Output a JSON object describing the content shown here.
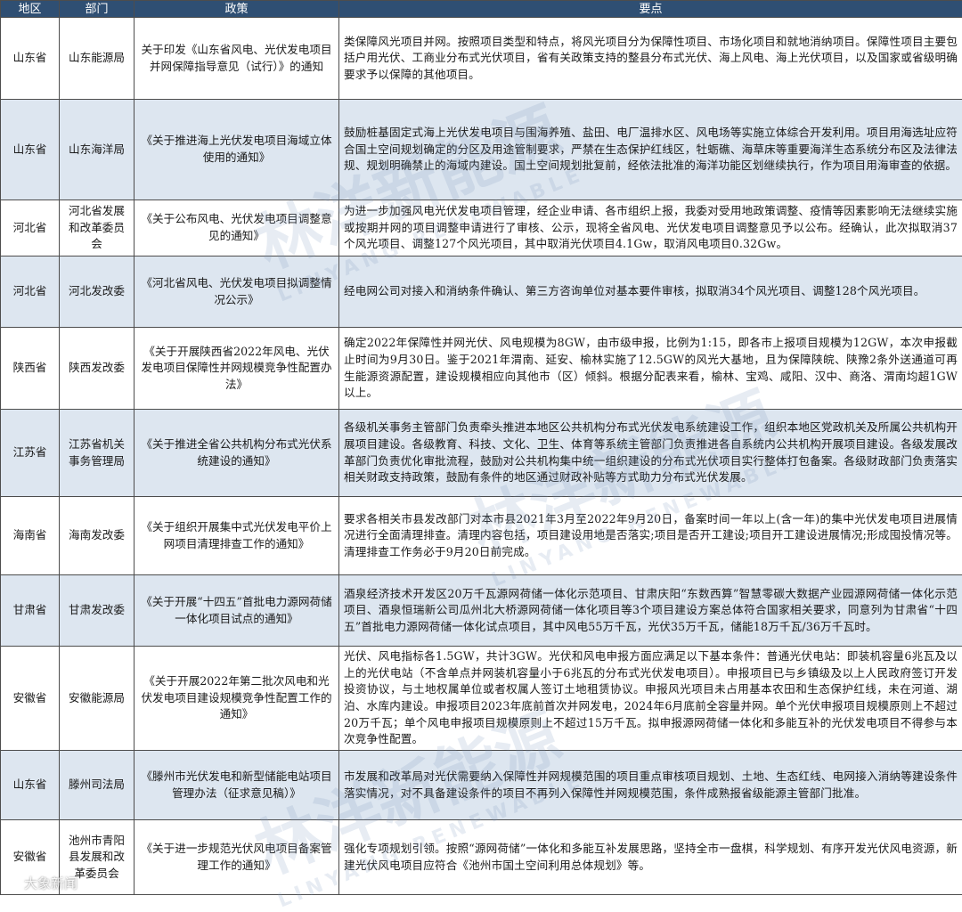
{
  "headers": {
    "region": "地区",
    "department": "部门",
    "policy": "政策",
    "points": "要点"
  },
  "rows": [
    {
      "region": "山东省",
      "department": "山东能源局",
      "policy": "关于印发《山东省风电、光伏发电项目并网保障指导意见（试行）》的通知",
      "points": "类保障风光项目并网。按照项目类型和特点，将风光项目分为保障性项目、市场化项目和就地消纳项目。保障性项目主要包括户用光伏、工商业分布式光伏项目，省有关政策支持的整县分布式光伏、海上风电、海上光伏项目，以及国家或省级明确要求予以保障的其他项目。"
    },
    {
      "region": "山东省",
      "department": "山东海洋局",
      "policy": "《关于推进海上光伏发电项目海域立体使用的通知》",
      "points": "鼓励桩基固定式海上光伏发电项目与围海养殖、盐田、电厂温排水区、风电场等实施立体综合开发利用。项目用海选址应符合国土空间规划确定的分区及用途管制要求，严禁在生态保护红线区，牡蛎礁、海草床等重要海洋生态系统分布区及法律法规、规划明确禁止的海域内建设。国土空间规划批复前，经依法批准的海洋功能区划继续执行，作为项目用海审查的依据。"
    },
    {
      "region": "河北省",
      "department": "河北省发展和改革委员会",
      "policy": "《关于公布风电、光伏发电项目调整意见的通知》",
      "points": "为进一步加强风电光伏发电项目管理，经企业申请、各市组织上报，我委对受用地政策调整、疫情等因素影响无法继续实施或按期并网的项目调整申请进行了审核、公示，现将全省风电、光伏发电项目调整意见予以公布。经确认，此次拟取消37个风光项目、调整127个风光项目，其中取消光伏项目4.1Gw，取消风电项目0.32Gw。"
    },
    {
      "region": "河北省",
      "department": "河北发改委",
      "policy": "《河北省风电、光伏发电项目拟调整情况公示》",
      "points": "经电网公司对接入和消纳条件确认、第三方咨询单位对基本要件审核，拟取消34个风光项目、调整128个风光项目。"
    },
    {
      "region": "陕西省",
      "department": "陕西发改委",
      "policy": "《关于开展陕西省2022年风电、光伏发电项目保障性并网规模竞争性配置办法》",
      "points": "确定2022年保障性并网光伏、风电规模为8GW，由市级申报，比例为1:15，即各市上报项目规模为12GW，本次申报截止时间为9月30日。鉴于2021年渭南、延安、榆林实施了12.5GW的风光大基地，且为保障陕皖、陕豫2条外送通道可再生能源资源配置，建设规模相应向其他市（区）倾斜。根据分配表来看，榆林、宝鸡、咸阳、汉中、商洛、渭南均超1GW以上。"
    },
    {
      "region": "江苏省",
      "department": "江苏省机关事务管理局",
      "policy": "《关于推进全省公共机构分布式光伏系统建设的通知》",
      "points": "各级机关事务主管部门负责牵头推进本地区公共机构分布式光伏发电系统建设工作，组织本地区党政机关及所属公共机构开展项目建设。各级教育、科技、文化、卫生、体育等系统主管部门负责推进各自系统内公共机构开展项目建设。各级发展改革部门负责优化审批流程，鼓励对公共机构集中统一组织建设的分布式光伏项目实行整体打包备案。各级财政部门负责落实相关财政支持政策，鼓励有条件的地区通过财政补贴等方式助力分布式光伏发展。"
    },
    {
      "region": "海南省",
      "department": "海南发改委",
      "policy": "《关于组织开展集中式光伏发电平价上网项目清理排查工作的通知》",
      "points": "要求各相关市县发改部门对本市县2021年3月至2022年9月20日，备案时间一年以上(含一年)的集中光伏发电项目进展情况进行全面清理排查。清理内容包括，项目建设用地是否落实;项目是否开工建设;项目开工建设进展情况;形成囤投情况等。清理排查工作务必于9月20日前完成。"
    },
    {
      "region": "甘肃省",
      "department": "甘肃发改委",
      "policy": "《关于开展“十四五”首批电力源网荷储一体化项目试点的通知》",
      "points": "酒泉经济技术开发区20万千瓦源网荷储一体化示范项目、甘肃庆阳“东数西算”智慧零碳大数据产业园源网荷储一体化示范项目、酒泉恒瑞新公司瓜州北大桥源网荷储一体化项目等3个项目建设方案总体符合国家相关要求，同意列为甘肃省“十四五”首批电力源网荷储一体化试点项目，其中风电55万千瓦，光伏35万千瓦，储能18万千瓦/36万千瓦时。"
    },
    {
      "region": "安徽省",
      "department": "安徽能源局",
      "policy": "《关于开展2022年第二批次风电和光伏发电项目建设规模竞争性配置工作的通知》",
      "points": "光伏、风电指标各1.5GW，共计3GW。光伏和风电申报方面应满足以下基本条件：普通光伏电站：即装机容量6兆瓦及以上的光伏电站（不含单点并网装机容量小于6兆瓦的分布式光伏发电项目）。申报项目已与乡镇级及以上人民政府签订开发投资协议，与土地权属单位或者权属人签订土地租赁协议。申报风光项目未占用基本农田和生态保护红线，未在河道、湖泊、水库内建设。申报项目2023年底前首次并网发电，2024年6月底前全容量并网。单个光伏申报项目规模原则上不超过20万千瓦；单个风电申报项目规模原则上不超过15万千瓦。拟申报源网荷储一体化和多能互补的光伏发电项目不得参与本次竞争性配置。"
    },
    {
      "region": "山东省",
      "department": "滕州司法局",
      "policy": "《滕州市光伏发电和新型储能电站项目管理办法（征求意见稿）》",
      "points": "市发展和改革局对光伏需要纳入保障性并网规模范围的项目重点审核项目规划、土地、生态红线、电网接入消纳等建设条件落实情况，对不具备建设条件的项目不再列入保障性并网规模范围，条件成熟报省级能源主管部门批准。"
    },
    {
      "region": "安徽省",
      "department": "池州市青阳县发展和改革委员会",
      "policy": "《关于进一步规范光伏风电项目备案管理工作的通知》",
      "points": "强化专项规划引领。按照“源网荷储”一体化和多能互补发展思路，坚持全市一盘棋，科学规划、有序开发光伏风电资源，新建光伏风电项目应符合《池州市国土空间利用总体规划》等。"
    }
  ],
  "watermark": {
    "text": "林洋新能源",
    "sub": "LINYANG RENEWABLE"
  },
  "corner_logo": {
    "text": "大象新闻",
    "icon": "elephant-logo-icon"
  }
}
